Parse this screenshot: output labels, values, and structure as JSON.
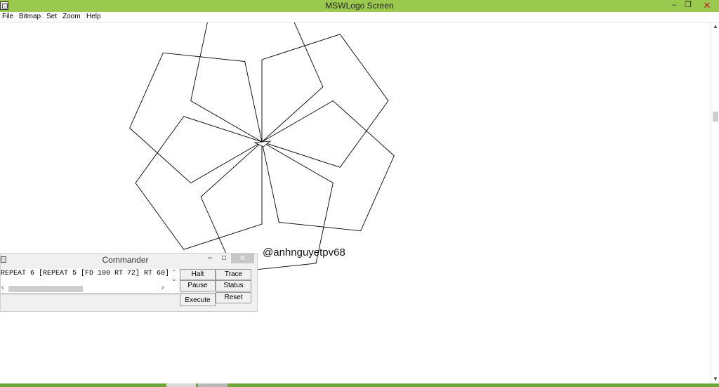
{
  "window": {
    "title": "MSWLogo Screen",
    "minimize_glyph": "–",
    "maximize_glyph": "❐",
    "close_glyph": "✕"
  },
  "menu": [
    "File",
    "Bitmap",
    "Set",
    "Zoom",
    "Help"
  ],
  "canvas": {
    "watermark": "@anhnguyetpv68",
    "program": {
      "repeat_outer": 6,
      "repeat_inner": 5,
      "forward": 100,
      "inner_turn": 72,
      "outer_turn": 60
    },
    "line_color": "#000000"
  },
  "scrollbar": {
    "up_glyph": "▲",
    "down_glyph": "▼"
  },
  "commander": {
    "title": "Commander",
    "minimize_glyph": "–",
    "maximize_glyph": "□",
    "close_glyph": "✕",
    "input_text": "REPEAT 6 [REPEAT 5 [FD 100 RT 72] RT 60]",
    "scroll_up_glyph": "⌃",
    "scroll_down_glyph": "⌄",
    "scroll_left_glyph": "‹",
    "scroll_right_glyph": "›",
    "buttons": {
      "halt": "Halt",
      "trace": "Trace",
      "pause": "Pause",
      "status": "Status",
      "execute": "Execute",
      "reset": "Reset"
    }
  },
  "colors": {
    "titlebar": "#9bc94f",
    "taskbar": "#6fa63a"
  }
}
